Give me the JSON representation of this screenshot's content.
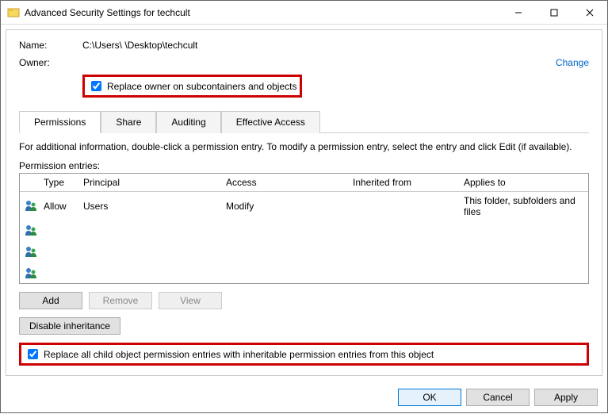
{
  "titlebar": {
    "title": "Advanced Security Settings for techcult"
  },
  "labels": {
    "name": "Name:",
    "owner": "Owner:",
    "name_value": "C:\\Users\\                            \\Desktop\\techcult",
    "change": "Change",
    "replace_owner": "Replace owner on subcontainers and objects",
    "info": "For additional information, double-click a permission entry. To modify a permission entry, select the entry and click Edit (if available).",
    "permission_entries": "Permission entries:",
    "replace_children": "Replace all child object permission entries with inheritable permission entries from this object"
  },
  "tabs": [
    {
      "label": "Permissions",
      "active": true
    },
    {
      "label": "Share",
      "active": false
    },
    {
      "label": "Auditing",
      "active": false
    },
    {
      "label": "Effective Access",
      "active": false
    }
  ],
  "grid": {
    "headers": {
      "type": "Type",
      "principal": "Principal",
      "access": "Access",
      "inherited": "Inherited from",
      "applies": "Applies to"
    },
    "rows": [
      {
        "type": "Allow",
        "principal": "Users",
        "access": "Modify",
        "inherited": "",
        "applies": "This folder, subfolders and files"
      },
      {
        "type": "",
        "principal": "",
        "access": "",
        "inherited": "",
        "applies": ""
      },
      {
        "type": "",
        "principal": "",
        "access": "",
        "inherited": "",
        "applies": ""
      },
      {
        "type": "",
        "principal": "",
        "access": "",
        "inherited": "",
        "applies": ""
      }
    ]
  },
  "buttons": {
    "add": "Add",
    "remove": "Remove",
    "view": "View",
    "disable_inh": "Disable inheritance",
    "ok": "OK",
    "cancel": "Cancel",
    "apply": "Apply"
  }
}
